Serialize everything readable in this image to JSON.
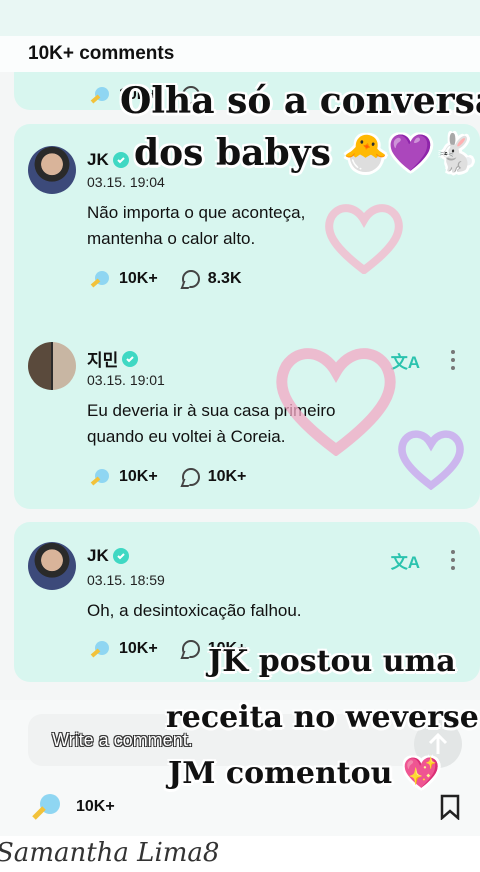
{
  "header": {
    "title": "10K+ comments"
  },
  "partial_card": {
    "like_count": "10K+"
  },
  "comments": [
    {
      "author": "JK",
      "date": "03.15. 19:04",
      "text_line1": "Não importa o que aconteça,",
      "text_line2": "mantenha o calor alto.",
      "likes": "10K+",
      "replies": "8.3K"
    },
    {
      "author": "지민",
      "date": "03.15. 19:01",
      "text_line1": "Eu deveria ir à sua casa primeiro",
      "text_line2": "quando eu voltei à Coreia.",
      "likes": "10K+",
      "replies": "10K+"
    },
    {
      "author": "JK",
      "date": "03.15. 18:59",
      "text_line1": "Oh, a desintoxicação falhou.",
      "likes": "10K+",
      "replies": "10K+"
    }
  ],
  "translate_glyph": "文A",
  "overlay_text": {
    "line1": "Olha só a conversa",
    "line2": "dos babys 🐣💜🐇",
    "line3": "JK postou uma",
    "line4": "receita no weverse",
    "line5": "JM comentou 💖"
  },
  "composer": {
    "placeholder": "Write a comment."
  },
  "footer": {
    "like_count": "10K+"
  },
  "watermark": "Samantha Lima8",
  "colors": {
    "card": "#d8f6ef",
    "accent": "#3fd8c3",
    "translate": "#2bc3ae"
  }
}
